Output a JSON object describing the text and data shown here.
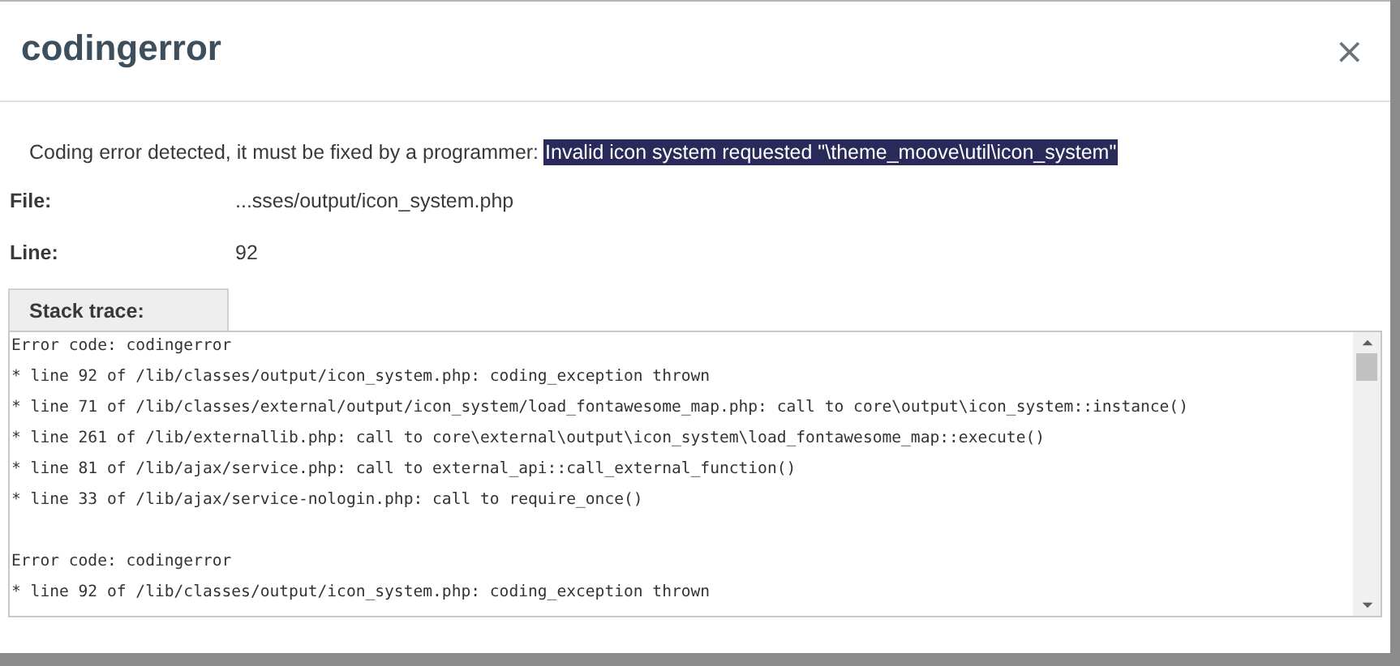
{
  "dialog": {
    "title": "codingerror",
    "close": "×"
  },
  "message": [
    {
      "text": "Coding error detected, it must be fixed by a programmer:",
      "highlighted": false
    },
    {
      "text": "Invalid icon system requested \"\\theme_moove\\util\\icon_system\"",
      "highlighted": true
    }
  ],
  "details": [
    {
      "label": "File:",
      "value": "...sses/output/icon_system.php"
    },
    {
      "label": "Line:",
      "value": "92"
    }
  ],
  "stack_trace": {
    "tab": "Stack trace:",
    "groups": [
      {
        "lines": [
          "Error code: codingerror",
          "* line 92 of /lib/classes/output/icon_system.php: coding_exception thrown",
          "* line 71 of /lib/classes/external/output/icon_system/load_fontawesome_map.php: call to core\\output\\icon_system::instance()",
          "* line 261 of /lib/externallib.php: call to core\\external\\output\\icon_system\\load_fontawesome_map::execute()",
          "* line 81 of /lib/ajax/service.php: call to external_api::call_external_function()",
          "* line 33 of /lib/ajax/service-nologin.php: call to require_once()"
        ]
      },
      {
        "lines": [
          "Error code: codingerror",
          "* line 92 of /lib/classes/output/icon_system.php: coding_exception thrown"
        ]
      }
    ]
  }
}
